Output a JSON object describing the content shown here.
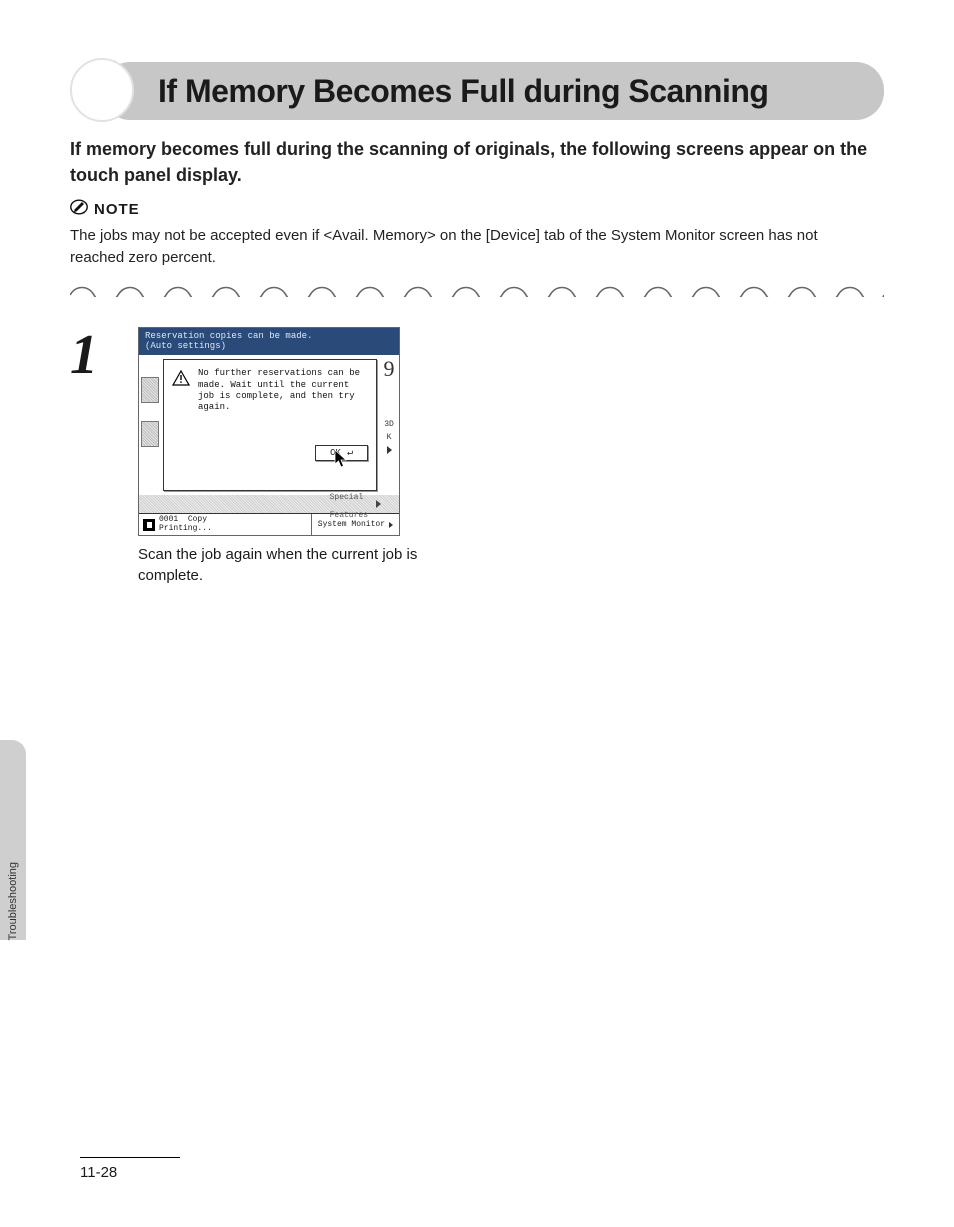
{
  "title": "If Memory Becomes Full during Scanning",
  "intro": "If memory becomes full during the scanning of originals, the following screens appear on the touch panel display.",
  "note": {
    "label": "NOTE",
    "body": "The jobs may not be accepted even if <Avail. Memory> on the [Device] tab of the System Monitor screen has not reached zero percent."
  },
  "step_number": "1",
  "dialog": {
    "title_line1": "Reservation copies can be made.",
    "title_line2": "(Auto settings)",
    "message": "No further reservations can be made. Wait until the current job is complete, and then try again.",
    "ok_label": "OK",
    "strip_label1": "Special",
    "strip_label2": "Features",
    "right_number": "9",
    "right_small1": "3D",
    "right_small2": "K",
    "status_job_id": "0001",
    "status_job_type": "Copy",
    "status_state": "Printing...",
    "system_monitor": "System Monitor"
  },
  "caption": "Scan the job again when the current job is complete.",
  "side_tab": "Troubleshooting",
  "page_number": "11-28"
}
